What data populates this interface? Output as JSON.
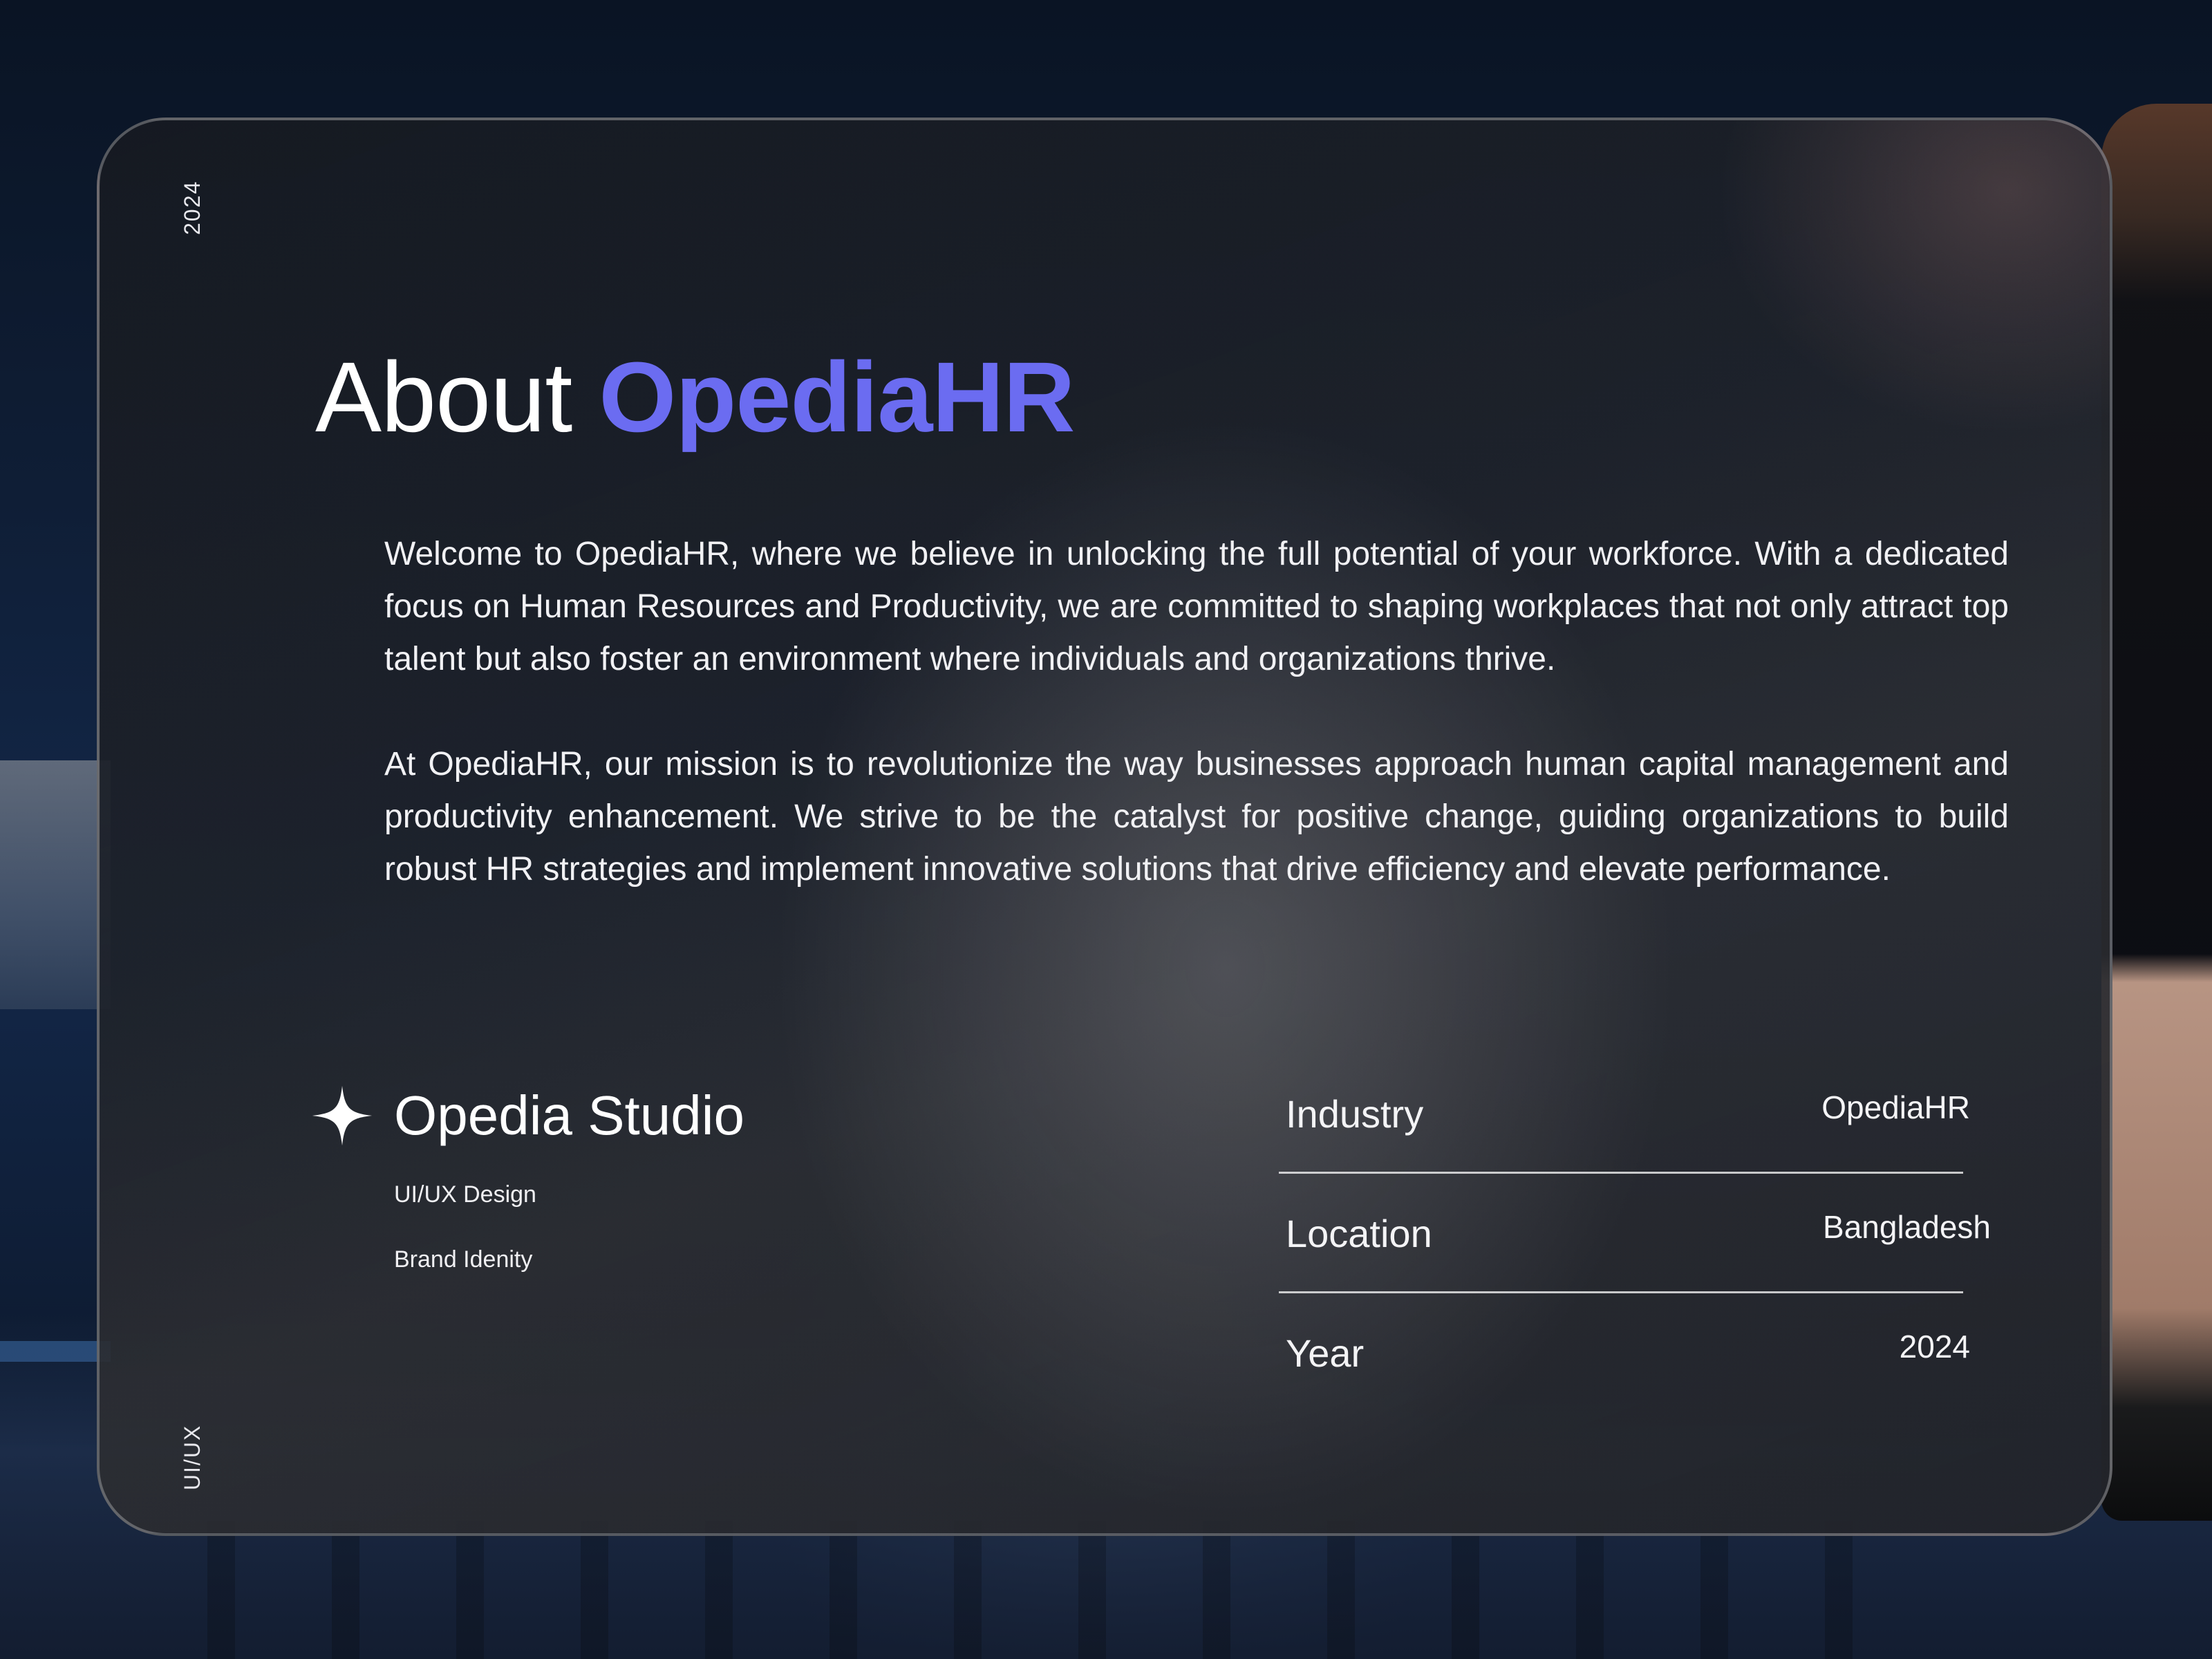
{
  "side": {
    "year": "2024",
    "category": "UI/UX"
  },
  "heading": {
    "prefix": "About",
    "brand": "OpediaHR",
    "brand_color": "#6b6cf1"
  },
  "paragraphs": [
    "Welcome to OpediaHR, where we believe in unlocking the full potential of your workforce. With a dedicated focus on Human Resources and Productivity, we are committed to shaping workplaces that not only attract top talent but also foster an environment where individuals and organizations thrive.",
    "At OpediaHR, our mission is to revolutionize the way businesses approach human capital management and productivity enhancement. We strive to be the catalyst for positive change, guiding organizations to build robust HR strategies and implement innovative solutions that drive efficiency and elevate performance."
  ],
  "studio": {
    "icon": "sparkle-icon",
    "name": "Opedia Studio",
    "tags": [
      "UI/UX Design",
      "Brand Idenity"
    ]
  },
  "info": [
    {
      "label": "Industry",
      "value": "OpediaHR"
    },
    {
      "label": "Location",
      "value": "Bangladesh"
    },
    {
      "label": "Year",
      "value": "2024"
    }
  ]
}
